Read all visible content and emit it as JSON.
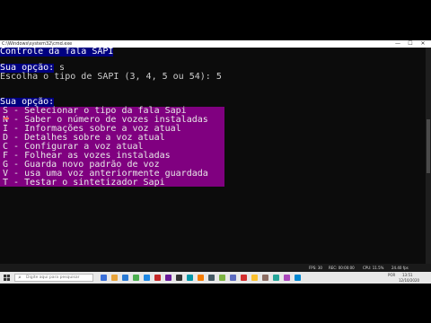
{
  "window": {
    "title": "C:\\Windows\\system32\\cmd.exe",
    "min": "—",
    "max": "☐",
    "close": "✕"
  },
  "console": {
    "header": "Controle da fala SAPI",
    "prompt1_label": "Sua opção:",
    "prompt1_value": " s",
    "type_question": "Escolha o tipo de SAPI (3, 4, 5 ou 54): 5",
    "prompt2_label": "Sua opção:",
    "menu_items": [
      "S - Selecionar o tipo da fala Sapi",
      "N - Saber o número de vozes instaladas",
      "I - Informações sobre a voz atual",
      "D - Detalhes sobre a voz atual",
      "C - Configurar a voz atual",
      "F - Folhear as vozes instaladas",
      "G - Guarda novo padrão de voz",
      "V - usa uma voz anteriormente guardada",
      "T - Testar o sintetizador Sapi"
    ]
  },
  "statusbar": {
    "fps": "FPS: 30",
    "rec": "REC: 00:00:00",
    "cpu": "CPU: 11.5%",
    "ram": "24.40 fps"
  },
  "taskbar": {
    "search_placeholder": "Digite aqui para pesquisar",
    "time": "13:51",
    "date": "12/10/2020",
    "lang": "POR"
  },
  "colors": {
    "header_bg": "#000080",
    "menu_bg": "#800080",
    "console_text": "#cccccc"
  }
}
